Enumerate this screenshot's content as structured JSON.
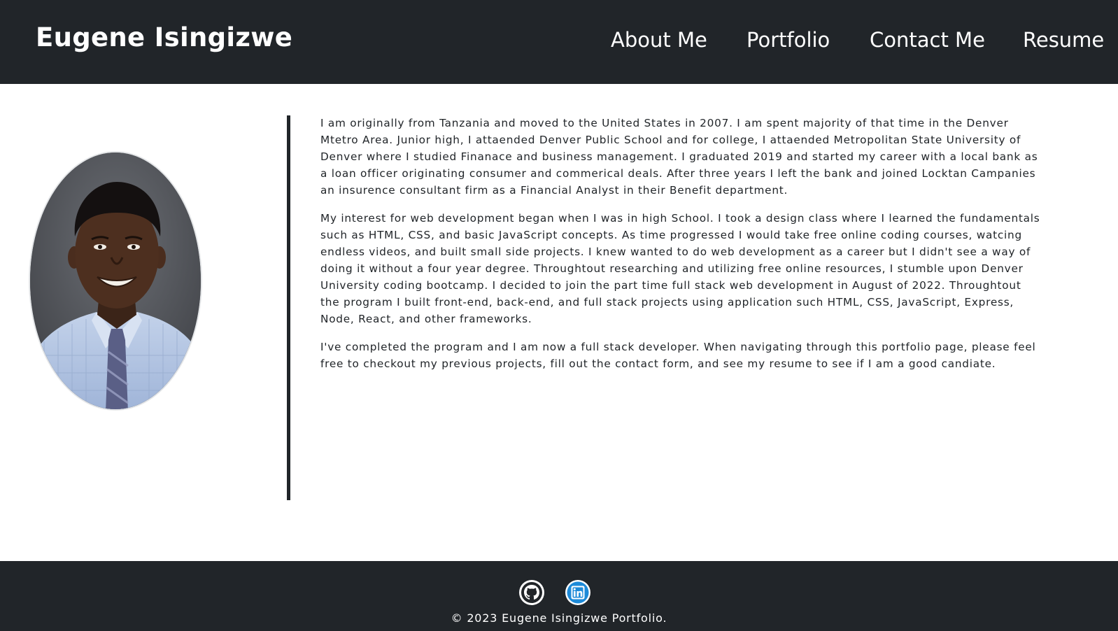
{
  "header": {
    "brand": "Eugene Isingizwe",
    "nav": [
      {
        "label": "About Me"
      },
      {
        "label": "Portfolio"
      },
      {
        "label": "Contact Me"
      },
      {
        "label": "Resume"
      }
    ]
  },
  "about": {
    "photo_icon": "profile-photo",
    "paragraphs": [
      "I am originally from Tanzania and moved to the United States in 2007. I am spent majority of that time in the Denver Mtetro Area. Junior high, I attaended Denver Public School and for college, I attaended Metropolitan State University of Denver where I studied Finanace and business management. I graduated 2019 and started my career with a local bank as a loan officer originating consumer and commerical deals. After three years I left the bank and joined Locktan Campanies an insurence consultant firm as a Financial Analyst in their Benefit department.",
      "My interest for web development began when I was in high School. I took a design class where I learned the fundamentals such as HTML, CSS, and basic JavaScript concepts. As time progressed I would take free online coding courses, watcing endless videos, and built small side projects. I knew wanted to do web development as a career but I didn't see a way of doing it without a four year degree. Throughtout researching and utilizing free online resources, I stumble upon Denver University coding bootcamp. I decided to join the part time full stack web development in August of 2022. Throughtout the program I built front-end, back-end, and full stack projects using application such HTML, CSS, JavaScript, Express, Node, React, and other frameworks.",
      "I've completed the program and I am now a full stack developer. When navigating through this portfolio page, please feel free to checkout my previous projects, fill out the contact form, and see my resume to see if I am a good candiate."
    ]
  },
  "footer": {
    "social": [
      {
        "icon": "github-icon"
      },
      {
        "icon": "linkedin-icon"
      }
    ],
    "copyright": "© 2023 Eugene Isingizwe Portfolio."
  },
  "colors": {
    "dark": "#212529",
    "text": "#212529",
    "linkedin": "#0a66c2"
  }
}
